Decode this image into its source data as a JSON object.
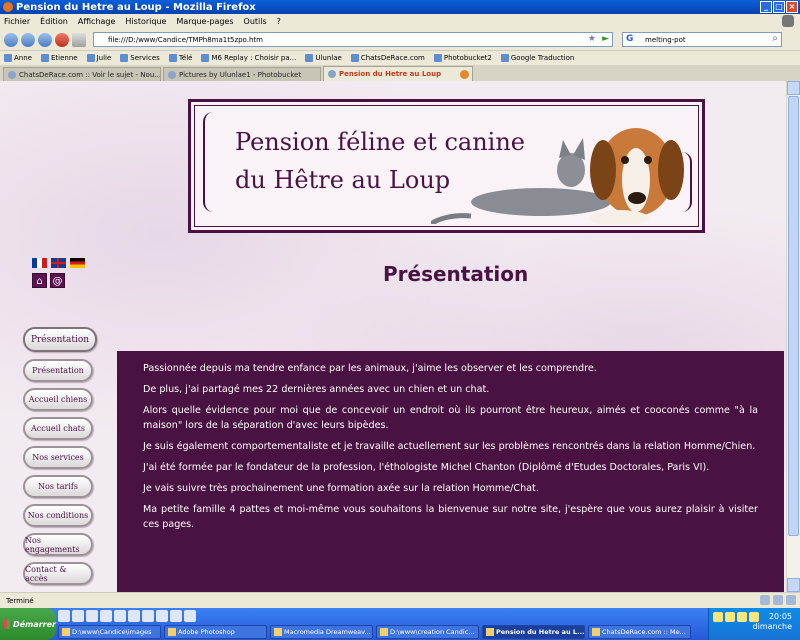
{
  "window": {
    "title": "Pension du Hetre au Loup - Mozilla Firefox"
  },
  "menu": [
    "Fichier",
    "Édition",
    "Affichage",
    "Historique",
    "Marque-pages",
    "Outils",
    "?"
  ],
  "navbar": {
    "url": "file:///D:/www/Candice/TMPh8ma1t5zpo.htm",
    "search_value": "melting-pot"
  },
  "bookmarks": [
    "Anne",
    "Etienne",
    "Julie",
    "Services",
    "Télé",
    "M6 Replay : Choisir pa...",
    "Ulunlae",
    "ChatsDeRace.com",
    "Photobucket2",
    "Google Traduction"
  ],
  "tabs": [
    {
      "label": "ChatsDeRace.com :: Voir le sujet - Nou..."
    },
    {
      "label": "Pictures by Ulunlae1 - Photobucket"
    },
    {
      "label": "Pension du Hetre au Loup"
    }
  ],
  "page": {
    "banner_line1": "Pension féline et canine",
    "banner_line2": "du Hêtre au Loup",
    "heading": "Présentation",
    "nav": [
      "Présentation",
      "Présentation",
      "Accueil chiens",
      "Accueil chats",
      "Nos services",
      "Nos tarifs",
      "Nos conditions",
      "Nos engagements",
      "Contact & accès"
    ],
    "paragraphs": [
      "Passionnée depuis ma tendre enfance par les animaux, j'aime les observer et les comprendre.",
      "De plus, j'ai partagé mes 22 dernières années avec un chien et un chat.",
      "Alors quelle évidence pour moi que de concevoir un endroit où ils pourront être heureux, aimés et cooconés comme \"à la maison\" lors de la séparation d'avec leurs bipèdes.",
      "Je suis également comportementaliste et je travaille actuellement sur les problèmes rencontrés dans la relation Homme/Chien.",
      "J'ai été formée par le fondateur de la profession, l'éthologiste Michel Chanton (Diplômé d'Etudes Doctorales, Paris VI).",
      "Je vais suivre très prochainement une formation axée sur la relation Homme/Chat.",
      "Ma petite famille 4 pattes et moi-même vous souhaitons la bienvenue sur notre site, j'espère que vous aurez plaisir à visiter ces pages."
    ]
  },
  "status": {
    "text": "Terminé"
  },
  "taskbar": {
    "start": "Démarrer",
    "tasks": [
      "D:\\www\\Candice\\images",
      "Adobe Photoshop",
      "Macromedia Dreamweav...",
      "D:\\www\\creation Candic...",
      "Pension du Hetre au L...",
      "ChatsDeRace.com :: Me..."
    ],
    "time": "20:05",
    "day": "dimanche"
  },
  "colors": {
    "brand_purple": "#4a1242",
    "page_bg": "#f3ebf2"
  }
}
